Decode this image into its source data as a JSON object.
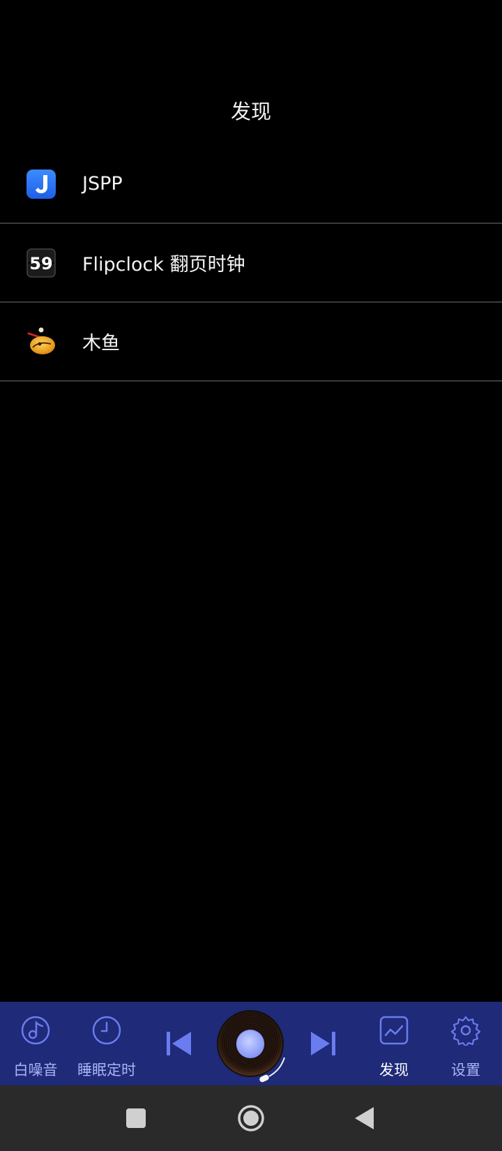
{
  "header": {
    "title": "发现"
  },
  "discover_list": [
    {
      "label": "JSPP",
      "icon": "jspp-app-icon"
    },
    {
      "label": "Flipclock 翻页时钟",
      "icon": "flipclock-app-icon",
      "icon_text": "59"
    },
    {
      "label": "木鱼",
      "icon": "wooden-fish-app-icon"
    }
  ],
  "bottom_nav": {
    "tabs": [
      {
        "label": "白噪音",
        "icon": "music-note-icon",
        "active": false
      },
      {
        "label": "睡眠定时",
        "icon": "clock-icon",
        "active": false
      },
      {
        "label": "发现",
        "icon": "chart-line-icon",
        "active": true
      },
      {
        "label": "设置",
        "icon": "gear-icon",
        "active": false
      }
    ],
    "player": {
      "previous": "skip-previous-icon",
      "disc": "vinyl-disc",
      "next": "skip-next-icon"
    }
  },
  "colors": {
    "background": "#000000",
    "bottom_bar": "#1f2a78",
    "accent": "#6b7cf0",
    "inactive_label": "#a9b4f5",
    "active_label": "#ffffff",
    "system_nav": "#2a2a2a"
  },
  "system_nav": {
    "buttons": [
      "recent-apps-icon",
      "home-icon",
      "back-icon"
    ]
  }
}
